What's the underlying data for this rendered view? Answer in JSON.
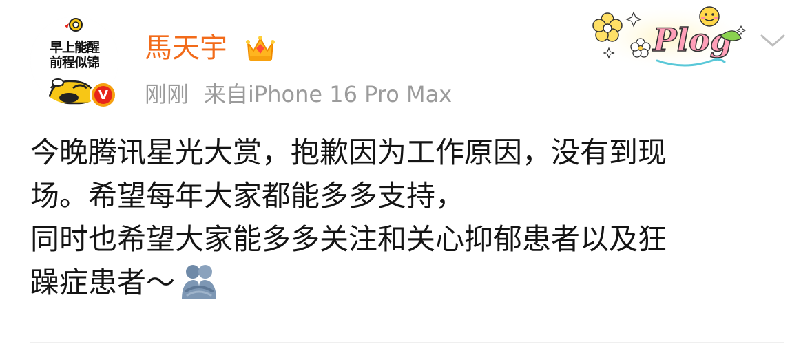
{
  "post": {
    "avatar": {
      "line1": "早上能醒",
      "line2": "前程似锦",
      "verified_letter": "V"
    },
    "author": {
      "name": "馬天宇"
    },
    "meta": {
      "time": "刚刚",
      "source": "来自iPhone 16 Pro Max"
    },
    "sticker": {
      "text": "Plog"
    },
    "content": {
      "lines": [
        "今晚腾讯星光大赏，抱歉因为工作原因，没有到现",
        "场。希望每年大家都能多多支持，",
        "同时也希望大家能多多关注和关心抑郁患者以及狂",
        "躁症患者～"
      ],
      "emoji": "hug-emoji"
    },
    "colors": {
      "username": "#f26b1a",
      "meta": "#9b9b9b",
      "text": "#141414",
      "verified_outer": "#f6a00f",
      "verified_inner": "#e8251a"
    }
  }
}
